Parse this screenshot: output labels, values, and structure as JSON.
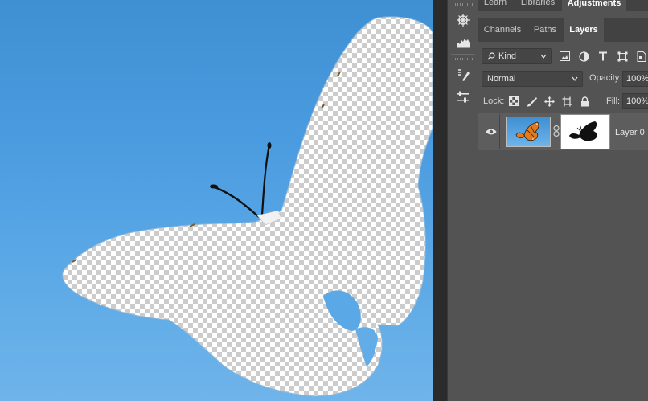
{
  "panel_tabs_top": {
    "learn": "Learn",
    "libraries": "Libraries",
    "adjustments": "Adjustments"
  },
  "panel_tabs": {
    "channels": "Channels",
    "paths": "Paths",
    "layers": "Layers"
  },
  "layers_panel": {
    "filter_kind": "Kind",
    "blend_mode": "Normal",
    "opacity_label": "Opacity:",
    "opacity_value": "100%",
    "lock_label": "Lock:",
    "fill_label": "Fill:",
    "fill_value": "100%",
    "layers": [
      {
        "name": "Layer 0",
        "visible": true,
        "has_mask": true
      }
    ]
  },
  "toolbar_icons": [
    "navigator-icon",
    "histogram-icon",
    "properties-icon",
    "brush-settings-icon"
  ],
  "colors": {
    "panel_bg": "#535353",
    "tab_bar": "#424242",
    "sky_top": "#3f8fd3",
    "sky_bottom": "#6fb4ea"
  }
}
